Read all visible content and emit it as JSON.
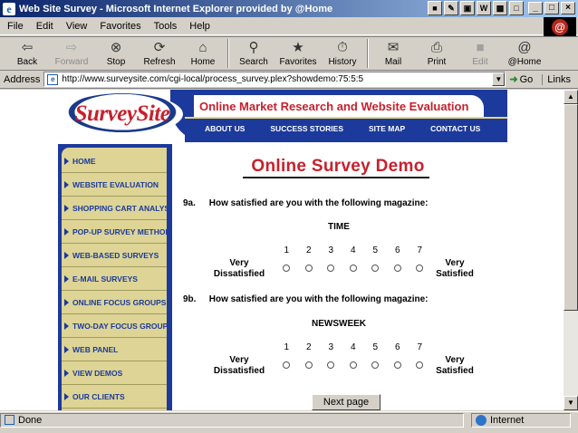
{
  "window": {
    "title": "Web Site Survey - Microsoft Internet Explorer provided by @Home"
  },
  "menu": [
    "File",
    "Edit",
    "View",
    "Favorites",
    "Tools",
    "Help"
  ],
  "toolbar": {
    "back": "Back",
    "forward": "Forward",
    "stop": "Stop",
    "refresh": "Refresh",
    "home": "Home",
    "search": "Search",
    "favorites": "Favorites",
    "history": "History",
    "mail": "Mail",
    "print": "Print",
    "edit": "Edit",
    "at_home": "@Home"
  },
  "address": {
    "label": "Address",
    "url": "http://www.surveysite.com/cgi-local/process_survey.plex?showdemo:75:5:5",
    "go": "Go",
    "links": "Links"
  },
  "banner": {
    "logo": "SurveySite",
    "slogan": "Online Market Research and Website Evaluation",
    "nav": [
      "ABOUT US",
      "SUCCESS STORIES",
      "SITE MAP",
      "CONTACT US"
    ]
  },
  "sidebar": {
    "items": [
      "HOME",
      "WEBSITE EVALUATION",
      "SHOPPING CART ANALYSIS",
      "POP-UP SURVEY METHOD",
      "WEB-BASED SURVEYS",
      "E-MAIL SURVEYS",
      "ONLINE FOCUS GROUPS",
      "TWO-DAY FOCUS GROUP",
      "WEB PANEL",
      "VIEW DEMOS",
      "OUR CLIENTS"
    ]
  },
  "survey": {
    "title": "Online Survey Demo",
    "questions": [
      {
        "number": "9a.",
        "text": "How satisfied are you with the following magazine:",
        "magazine": "TIME",
        "left_anchor_1": "Very",
        "left_anchor_2": "Dissatisfied",
        "right_anchor_1": "Very",
        "right_anchor_2": "Satisfied",
        "scale": [
          "1",
          "2",
          "3",
          "4",
          "5",
          "6",
          "7"
        ]
      },
      {
        "number": "9b.",
        "text": "How satisfied are you with the following magazine:",
        "magazine": "NEWSWEEK",
        "left_anchor_1": "Very",
        "left_anchor_2": "Dissatisfied",
        "right_anchor_1": "Very",
        "right_anchor_2": "Satisfied",
        "scale": [
          "1",
          "2",
          "3",
          "4",
          "5",
          "6",
          "7"
        ]
      }
    ],
    "next_button": "Next page"
  },
  "status": {
    "text": "Done",
    "zone": "Internet"
  }
}
